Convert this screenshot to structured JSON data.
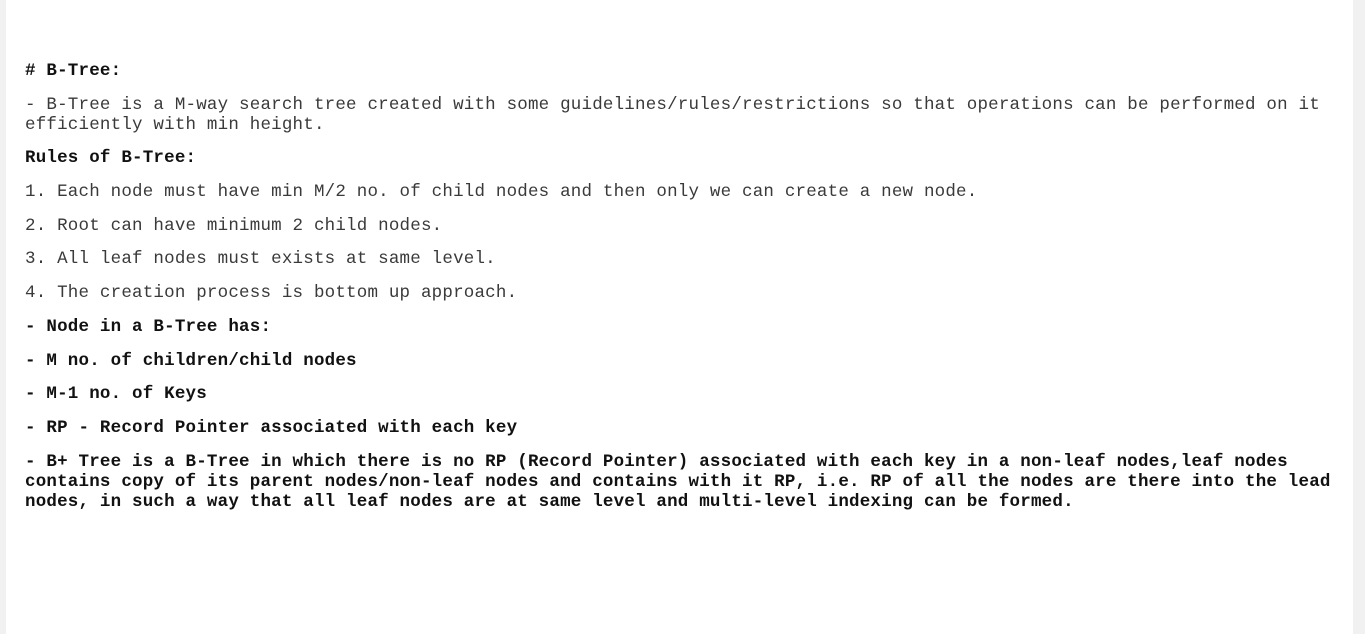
{
  "document": {
    "heading": "# B-Tree:",
    "intro": "- B-Tree is a M-way search tree created with some guidelines/rules/restrictions so that operations can be performed on it efficiently with min height.",
    "rules_title": "Rules of B-Tree:",
    "rules": [
      "1. Each node must have min M/2 no. of child nodes and then only we can create a new node.",
      "2. Root can have minimum 2 child nodes.",
      "3. All leaf nodes must exists at same level.",
      "4. The creation process is bottom up approach."
    ],
    "node_title": "- Node in a B-Tree has:",
    "node_items": [
      "- M no. of children/child nodes",
      "- M-1 no. of Keys",
      "- RP - Record Pointer associated with each key"
    ],
    "bplus_note": "- B+ Tree is a B-Tree in which there is no RP (Record Pointer) associated with each key in a non-leaf nodes,leaf nodes contains copy of its parent nodes/non-leaf nodes and contains with it RP, i.e. RP of all the nodes are there into the lead nodes, in such a way that all leaf nodes are at same level and multi-level indexing can be formed."
  }
}
